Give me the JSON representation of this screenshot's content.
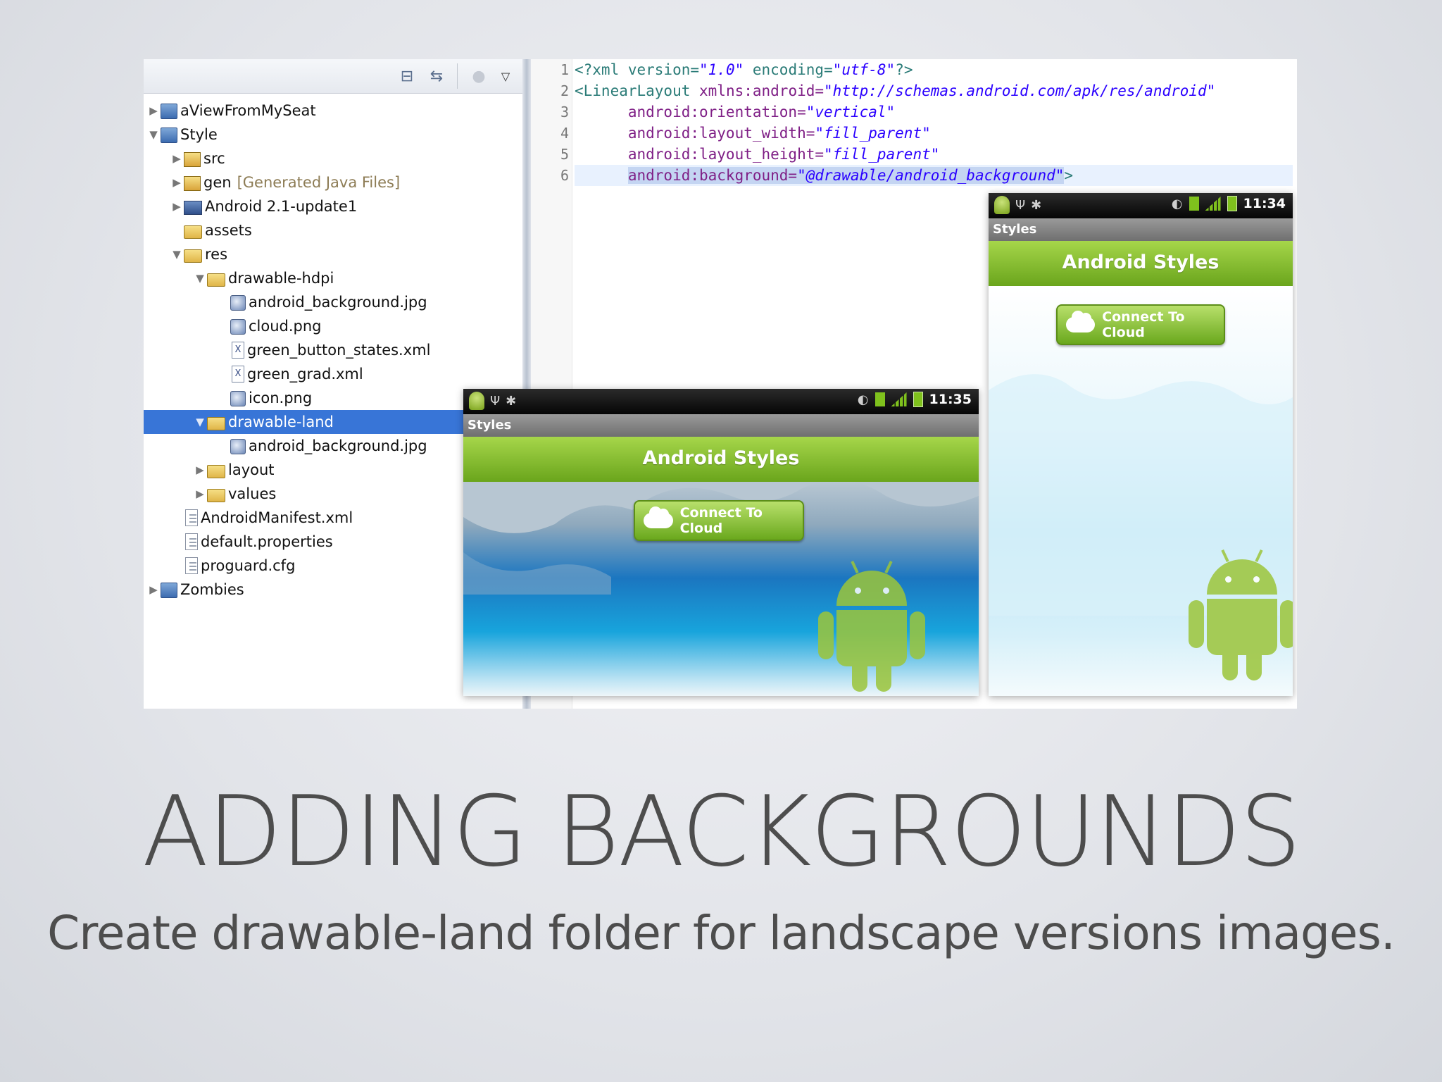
{
  "slide": {
    "title": "ADDING BACKGROUNDS",
    "subtitle": "Create drawable-land folder for landscape versions images."
  },
  "explorer": {
    "toolbar_icons": [
      "collapse-all-icon",
      "link-with-editor-icon",
      "focus-icon",
      "view-menu-icon"
    ],
    "tree": [
      {
        "label": "aViewFromMySeat",
        "icon": "project-icon",
        "expanded": false,
        "depth": 0
      },
      {
        "label": "Style",
        "icon": "project-icon",
        "expanded": true,
        "depth": 0
      },
      {
        "label": "src",
        "icon": "package-folder-icon",
        "expanded": false,
        "depth": 1
      },
      {
        "label": "gen",
        "suffix": "[Generated Java Files]",
        "icon": "package-folder-icon",
        "expanded": false,
        "depth": 1
      },
      {
        "label": "Android 2.1-update1",
        "icon": "library-icon",
        "expanded": false,
        "depth": 1
      },
      {
        "label": "assets",
        "icon": "folder-icon",
        "depth": 1
      },
      {
        "label": "res",
        "icon": "folder-icon",
        "expanded": true,
        "depth": 1
      },
      {
        "label": "drawable-hdpi",
        "icon": "folder-icon",
        "expanded": true,
        "depth": 2
      },
      {
        "label": "android_background.jpg",
        "icon": "image-file-icon",
        "depth": 3
      },
      {
        "label": "cloud.png",
        "icon": "image-file-icon",
        "depth": 3
      },
      {
        "label": "green_button_states.xml",
        "icon": "xml-file-icon",
        "depth": 3
      },
      {
        "label": "green_grad.xml",
        "icon": "xml-file-icon",
        "depth": 3
      },
      {
        "label": "icon.png",
        "icon": "image-file-icon",
        "depth": 3
      },
      {
        "label": "drawable-land",
        "icon": "folder-icon",
        "expanded": true,
        "depth": 2,
        "selected": true
      },
      {
        "label": "android_background.jpg",
        "icon": "image-file-icon",
        "depth": 3
      },
      {
        "label": "layout",
        "icon": "folder-icon",
        "expanded": false,
        "depth": 2
      },
      {
        "label": "values",
        "icon": "folder-icon",
        "expanded": false,
        "depth": 2
      },
      {
        "label": "AndroidManifest.xml",
        "icon": "manifest-file-icon",
        "depth": 1
      },
      {
        "label": "default.properties",
        "icon": "text-file-icon",
        "depth": 1
      },
      {
        "label": "proguard.cfg",
        "icon": "text-file-icon",
        "depth": 1
      },
      {
        "label": "Zombies",
        "icon": "project-icon",
        "expanded": false,
        "depth": 0
      }
    ]
  },
  "editor": {
    "line_numbers": [
      "1",
      "2",
      "3",
      "4",
      "5",
      "6"
    ],
    "line1": {
      "decl": "<?xml version=",
      "v1": "\"1.0\"",
      "enc": " encoding=",
      "v2": "\"utf-8\"",
      "end": "?>"
    },
    "line2": {
      "tag": "<LinearLayout",
      "attr": " xmlns:android=",
      "val": "\"http://schemas.android.com/apk/res/android\""
    },
    "line3": {
      "attr": "android:orientation=",
      "val": "\"vertical\""
    },
    "line4": {
      "attr": "android:layout_width=",
      "val": "\"fill_parent\""
    },
    "line5": {
      "attr": "android:layout_height=",
      "val": "\"fill_parent\""
    },
    "line6": {
      "attr": "android:background=",
      "val": "\"@drawable/android_background\"",
      "end": ">"
    }
  },
  "phone_landscape": {
    "time": "11:35",
    "title": "Styles",
    "header": "Android Styles",
    "button": "Connect To Cloud"
  },
  "phone_portrait": {
    "time": "11:34",
    "title": "Styles",
    "header": "Android Styles",
    "button": "Connect To Cloud"
  },
  "colors": {
    "selection": "#3875d7",
    "android_green": "#9cc53a",
    "header_green": "#7fb82a",
    "sky_blue": "#1d7fc4"
  }
}
